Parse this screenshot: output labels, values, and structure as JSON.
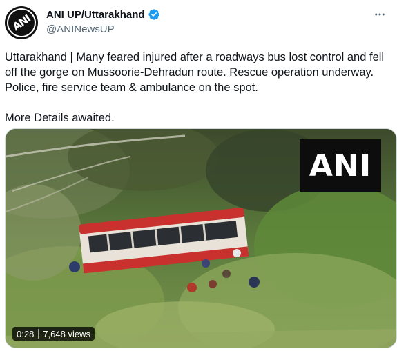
{
  "account": {
    "display_name": "ANI UP/Uttarakhand",
    "handle": "@ANINewsUP",
    "avatar_text": "ANI",
    "verified": true
  },
  "tweet": {
    "text": "Uttarakhand | Many feared injured after a roadways bus lost control and fell off the gorge on Mussoorie-Dehradun route. Rescue operation underway. Police, fire service team & ambulance on the spot.\n\nMore Details awaited."
  },
  "media": {
    "watermark": "ANI",
    "duration": "0:28",
    "views": "7,648 views"
  },
  "icons": {
    "verified": "verified-badge-icon",
    "more": "more-options-icon"
  },
  "colors": {
    "verified_blue": "#1d9bf0",
    "secondary_text": "#536471"
  }
}
